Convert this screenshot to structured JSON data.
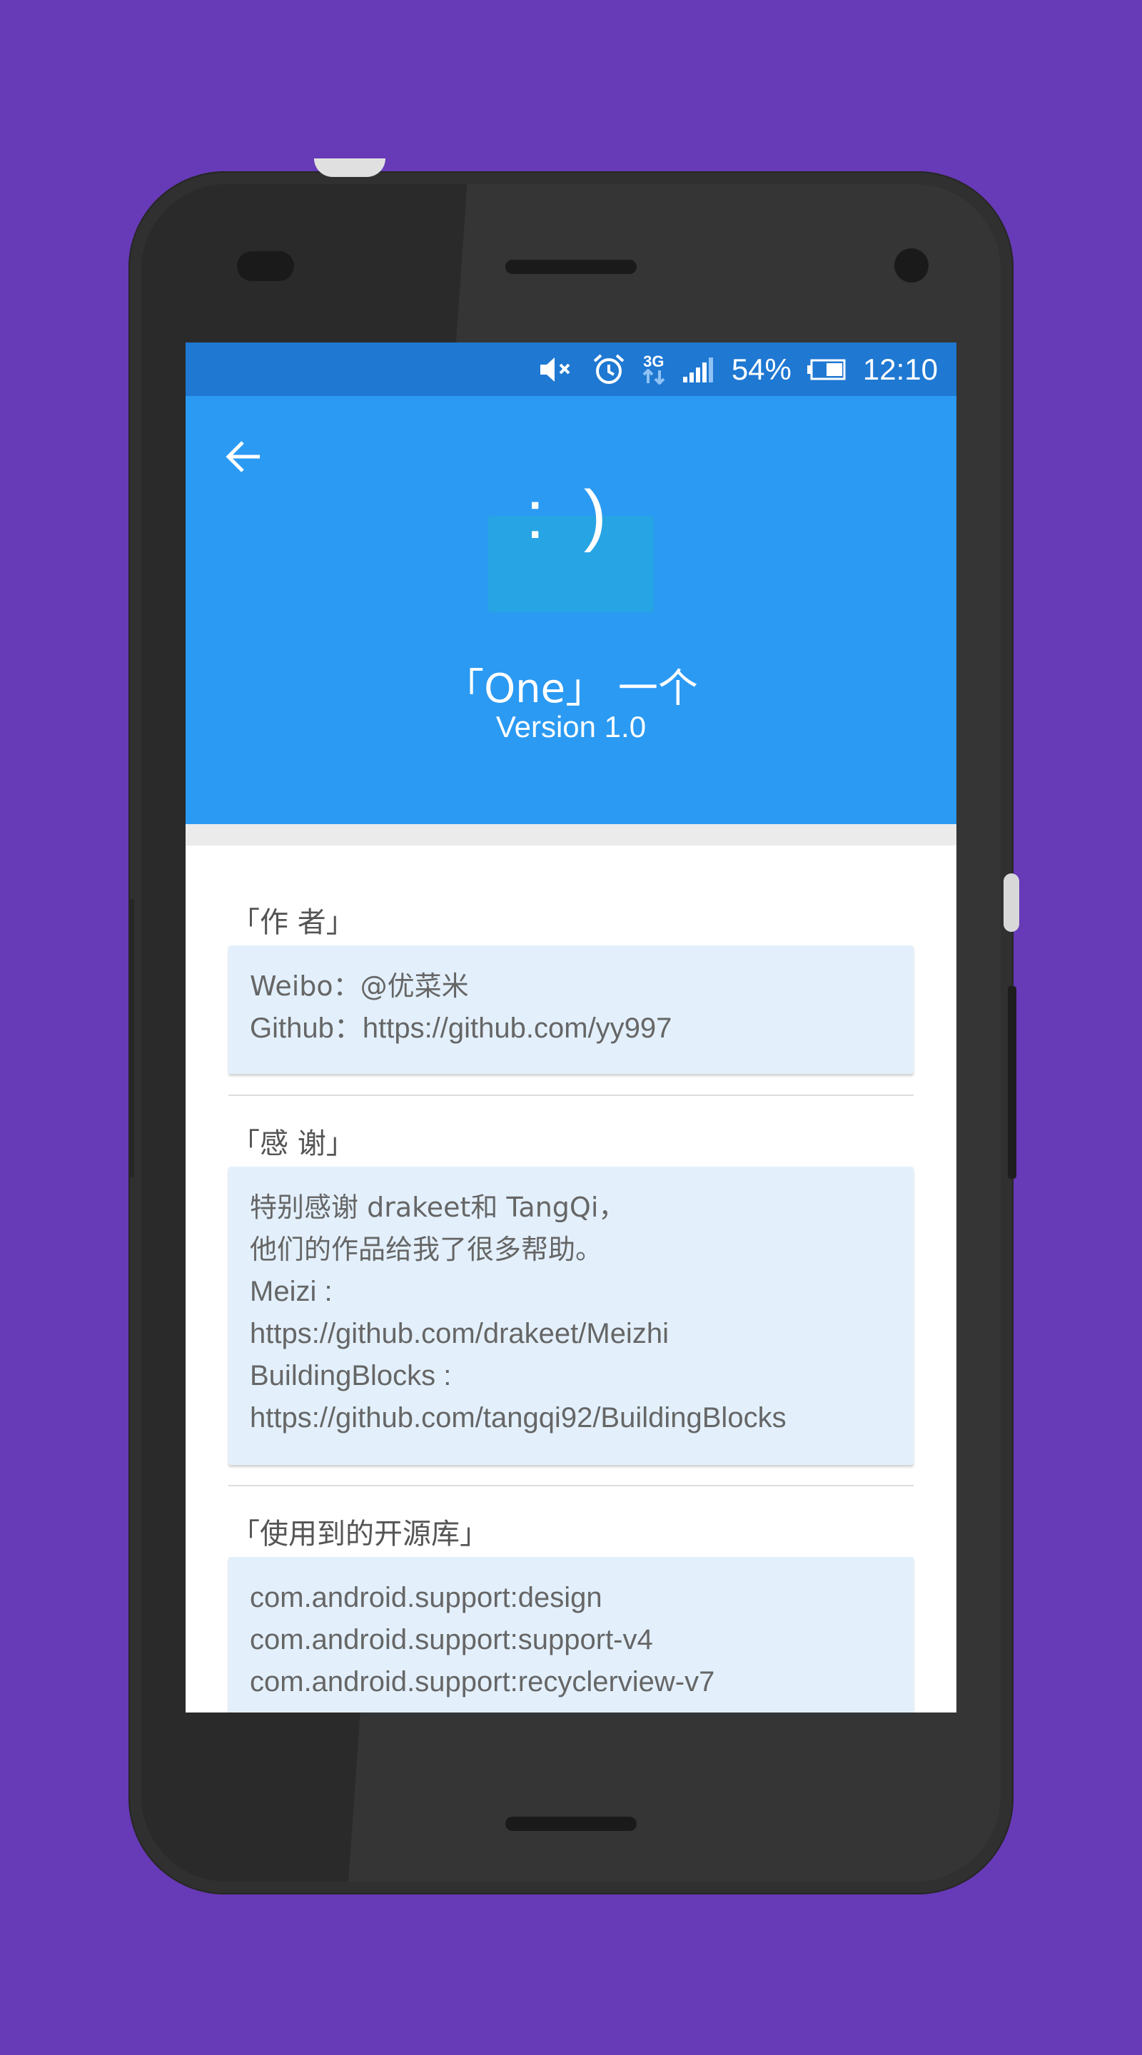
{
  "status_bar": {
    "network": "3G",
    "battery_percent": "54%",
    "time": "12:10",
    "icons": [
      "mute-icon",
      "alarm-icon",
      "network-3g-icon",
      "signal-icon",
      "battery-icon"
    ]
  },
  "header": {
    "back_icon": "arrow-left-icon",
    "logo_text": ": )",
    "app_title": "「One」 一个",
    "version": "Version 1.0"
  },
  "sections": [
    {
      "title": "「作  者」",
      "lines": [
        "Weibo：@优菜米",
        "Github：https://github.com/yy997"
      ]
    },
    {
      "title": "「感 谢」",
      "lines": [
        "特别感谢 drakeet和 TangQi，",
        "他们的作品给我了很多帮助。",
        "Meizi :",
        "https://github.com/drakeet/Meizhi",
        "BuildingBlocks :",
        "https://github.com/tangqi92/BuildingBlocks"
      ]
    },
    {
      "title": "「使用到的开源库」",
      "lines": [
        "com.android.support:design",
        "com.android.support:support-v4",
        "com.android.support:recyclerview-v7"
      ]
    }
  ],
  "colors": {
    "background": "#673ab7",
    "status_bar": "#1f78d2",
    "header": "#2b9af3",
    "card": "#e3f0fc"
  }
}
